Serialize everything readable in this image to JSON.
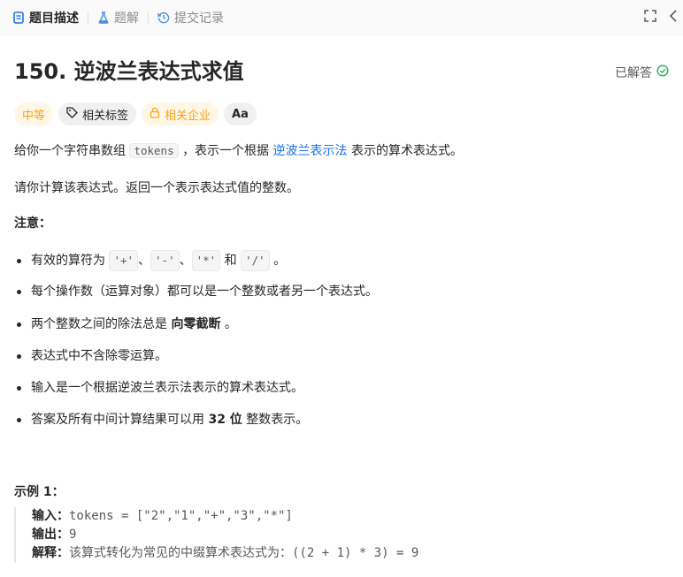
{
  "tabs": [
    {
      "label": "题目描述",
      "icon": "description-icon",
      "active": true
    },
    {
      "label": "题解",
      "icon": "flask-icon",
      "active": false
    },
    {
      "label": "提交记录",
      "icon": "history-icon",
      "active": false
    }
  ],
  "problem": {
    "title": "150. 逆波兰表达式求值",
    "status": "已解答",
    "chips": [
      "中等",
      "相关标签",
      "相关企业",
      "Aa"
    ]
  },
  "description": {
    "p1_pre": "给你一个字符串数组",
    "p1_code": "tokens",
    "p1_mid": "，表示一个根据",
    "p1_link": "逆波兰表示法",
    "p1_post": "表示的算术表达式。",
    "p2": "请你计算该表达式。返回一个表示表达式值的整数。",
    "note_title": "注意：",
    "note1_pre": "有效的算符为",
    "op_plus": "'+'",
    "sep1": "、",
    "op_minus": "'-'",
    "sep2": "、",
    "op_mul": "'*'",
    "and": "和",
    "op_div": "'/'",
    "note1_post": "。",
    "note2": "每个操作数（运算对象）都可以是一个整数或者另一个表达式。",
    "note3_pre": "两个整数之间的除法总是",
    "note3_bold": "向零截断",
    "note3_post": "。",
    "note4": "表达式中不含除零运算。",
    "note5": "输入是一个根据逆波兰表示法表示的算术表达式。",
    "note6_pre": "答案及所有中间计算结果可以用",
    "note6_bold": "32 位",
    "note6_post": "整数表示。"
  },
  "example": {
    "title": "示例 1：",
    "input_label": "输入：",
    "input_value": "tokens = [\"2\",\"1\",\"+\",\"3\",\"*\"]",
    "output_label": "输出：",
    "output_value": "9",
    "explain_label": "解释：",
    "explain_value": "该算式转化为常见的中缀算术表达式为：((2 + 1) * 3) = 9"
  }
}
